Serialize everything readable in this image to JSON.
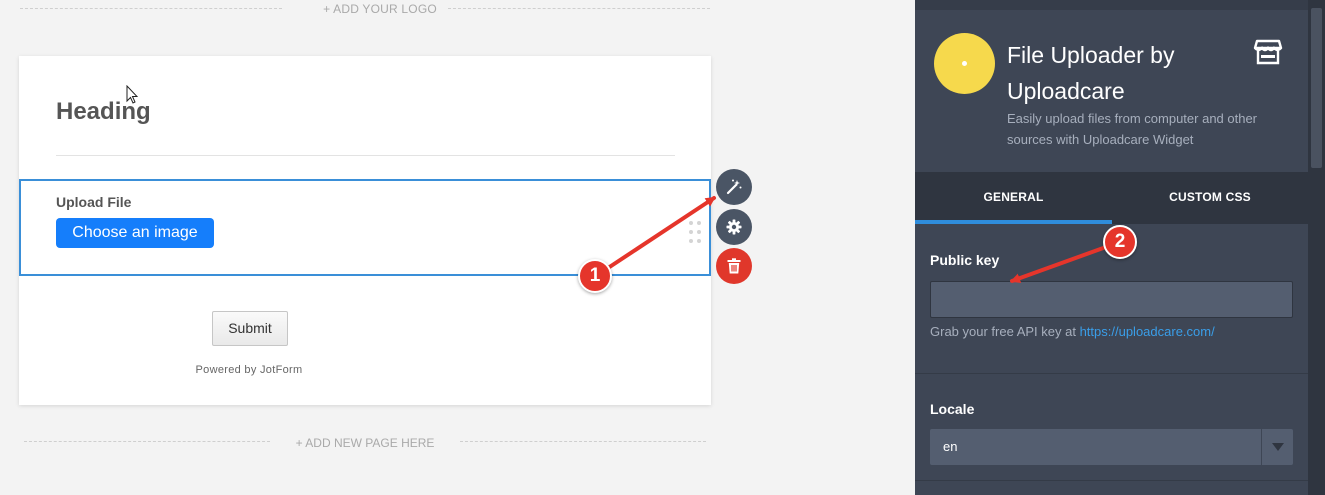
{
  "canvas": {
    "logo_placeholder": "+ ADD YOUR LOGO",
    "new_page_placeholder": "+ ADD NEW PAGE HERE"
  },
  "form": {
    "heading": "Heading",
    "upload_label": "Upload File",
    "choose_button": "Choose an image",
    "submit_button": "Submit",
    "powered_by": "Powered by JotForm"
  },
  "field_tools": {
    "wand_icon": "magic-wand-icon",
    "gear_icon": "gear-icon",
    "trash_icon": "trash-icon"
  },
  "panel": {
    "title": "File Uploader by Uploadcare",
    "description": "Easily upload files from computer and other sources with Uploadcare Widget",
    "store_icon": "store-icon",
    "tabs": [
      {
        "label": "GENERAL",
        "active": true
      },
      {
        "label": "CUSTOM CSS",
        "active": false
      }
    ],
    "public_key": {
      "label": "Public key",
      "value": "",
      "hint_prefix": "Grab your free API key at ",
      "hint_link": "https://uploadcare.com/"
    },
    "locale": {
      "label": "Locale",
      "selected": "en"
    }
  },
  "annotations": {
    "badge_1": "1",
    "badge_2": "2"
  },
  "colors": {
    "accent_blue": "#157efb",
    "panel_bg": "#3e4655",
    "badge_red": "#e5352b",
    "app_icon_yellow": "#f6d94c"
  }
}
